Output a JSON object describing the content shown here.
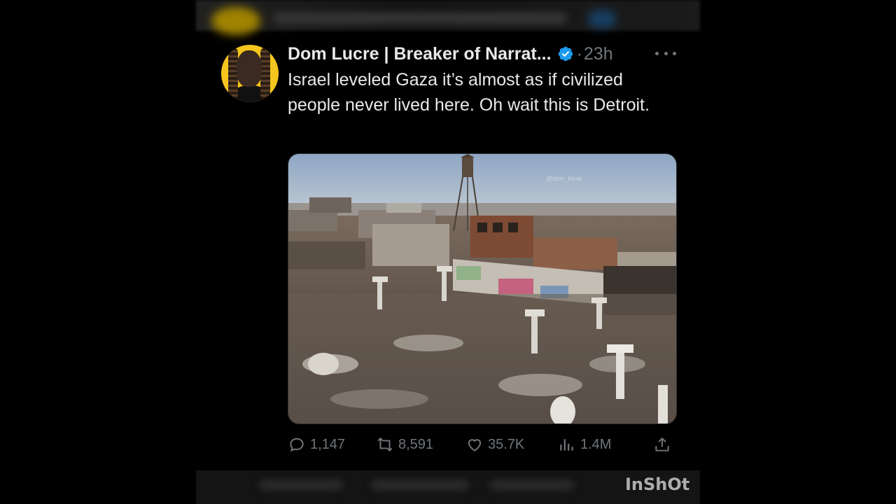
{
  "tweet": {
    "display_name": "Dom Lucre | Breaker of Narrat...",
    "dot": "·",
    "time": "23h",
    "text": "Israel leveled Gaza it’s almost as if civilized people never lived here. Oh wait this is Detroit.",
    "media_watermark": "@dom_lucre",
    "metrics": {
      "replies": "1,147",
      "retweets": "8,591",
      "likes": "35.7K",
      "views": "1.4M"
    }
  },
  "colors": {
    "background": "#000000",
    "text_primary": "#e7e9ea",
    "text_secondary": "#71767b",
    "verified_blue": "#1d9bf0",
    "avatar_bg": "#f4c51c"
  },
  "icons": [
    "verified-badge-icon",
    "more-icon",
    "reply-icon",
    "retweet-icon",
    "like-icon",
    "views-icon",
    "share-icon"
  ],
  "app_watermark": "InShOt"
}
